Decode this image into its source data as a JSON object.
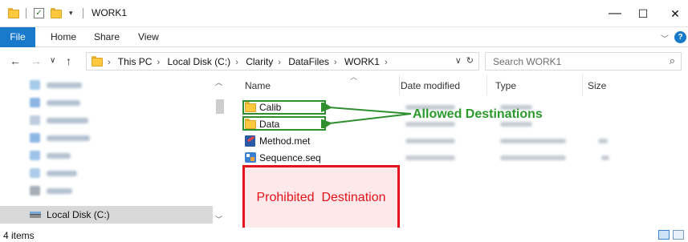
{
  "window": {
    "title": "WORK1",
    "minimize": "—",
    "maximize": "☐",
    "close": "✕"
  },
  "ribbon": {
    "tabs": [
      "File",
      "Home",
      "Share",
      "View"
    ],
    "expand_icon": "chevron-down-icon",
    "help_icon": "help-icon",
    "accent_color": "#1979ca"
  },
  "address": {
    "breadcrumbs": [
      "This PC",
      "Local Disk (C:)",
      "Clarity",
      "DataFiles",
      "WORK1"
    ],
    "search_placeholder": "Search WORK1"
  },
  "nav_pane": {
    "selected_item": "Local Disk (C:)"
  },
  "file_list": {
    "columns": [
      "Name",
      "Date modified",
      "Type",
      "Size"
    ],
    "items": [
      {
        "name": "Calib",
        "icon": "folder-icon"
      },
      {
        "name": "Data",
        "icon": "folder-icon"
      },
      {
        "name": "Method.met",
        "icon": "method-file-icon"
      },
      {
        "name": "Sequence.seq",
        "icon": "sequence-file-icon"
      }
    ]
  },
  "annotations": {
    "allowed": "Allowed Destinations",
    "allowed_color": "#2a9a2a",
    "prohibited": "Prohibited  Destination",
    "prohibited_color": "#e3121b"
  },
  "status": {
    "item_count": "4 items"
  }
}
